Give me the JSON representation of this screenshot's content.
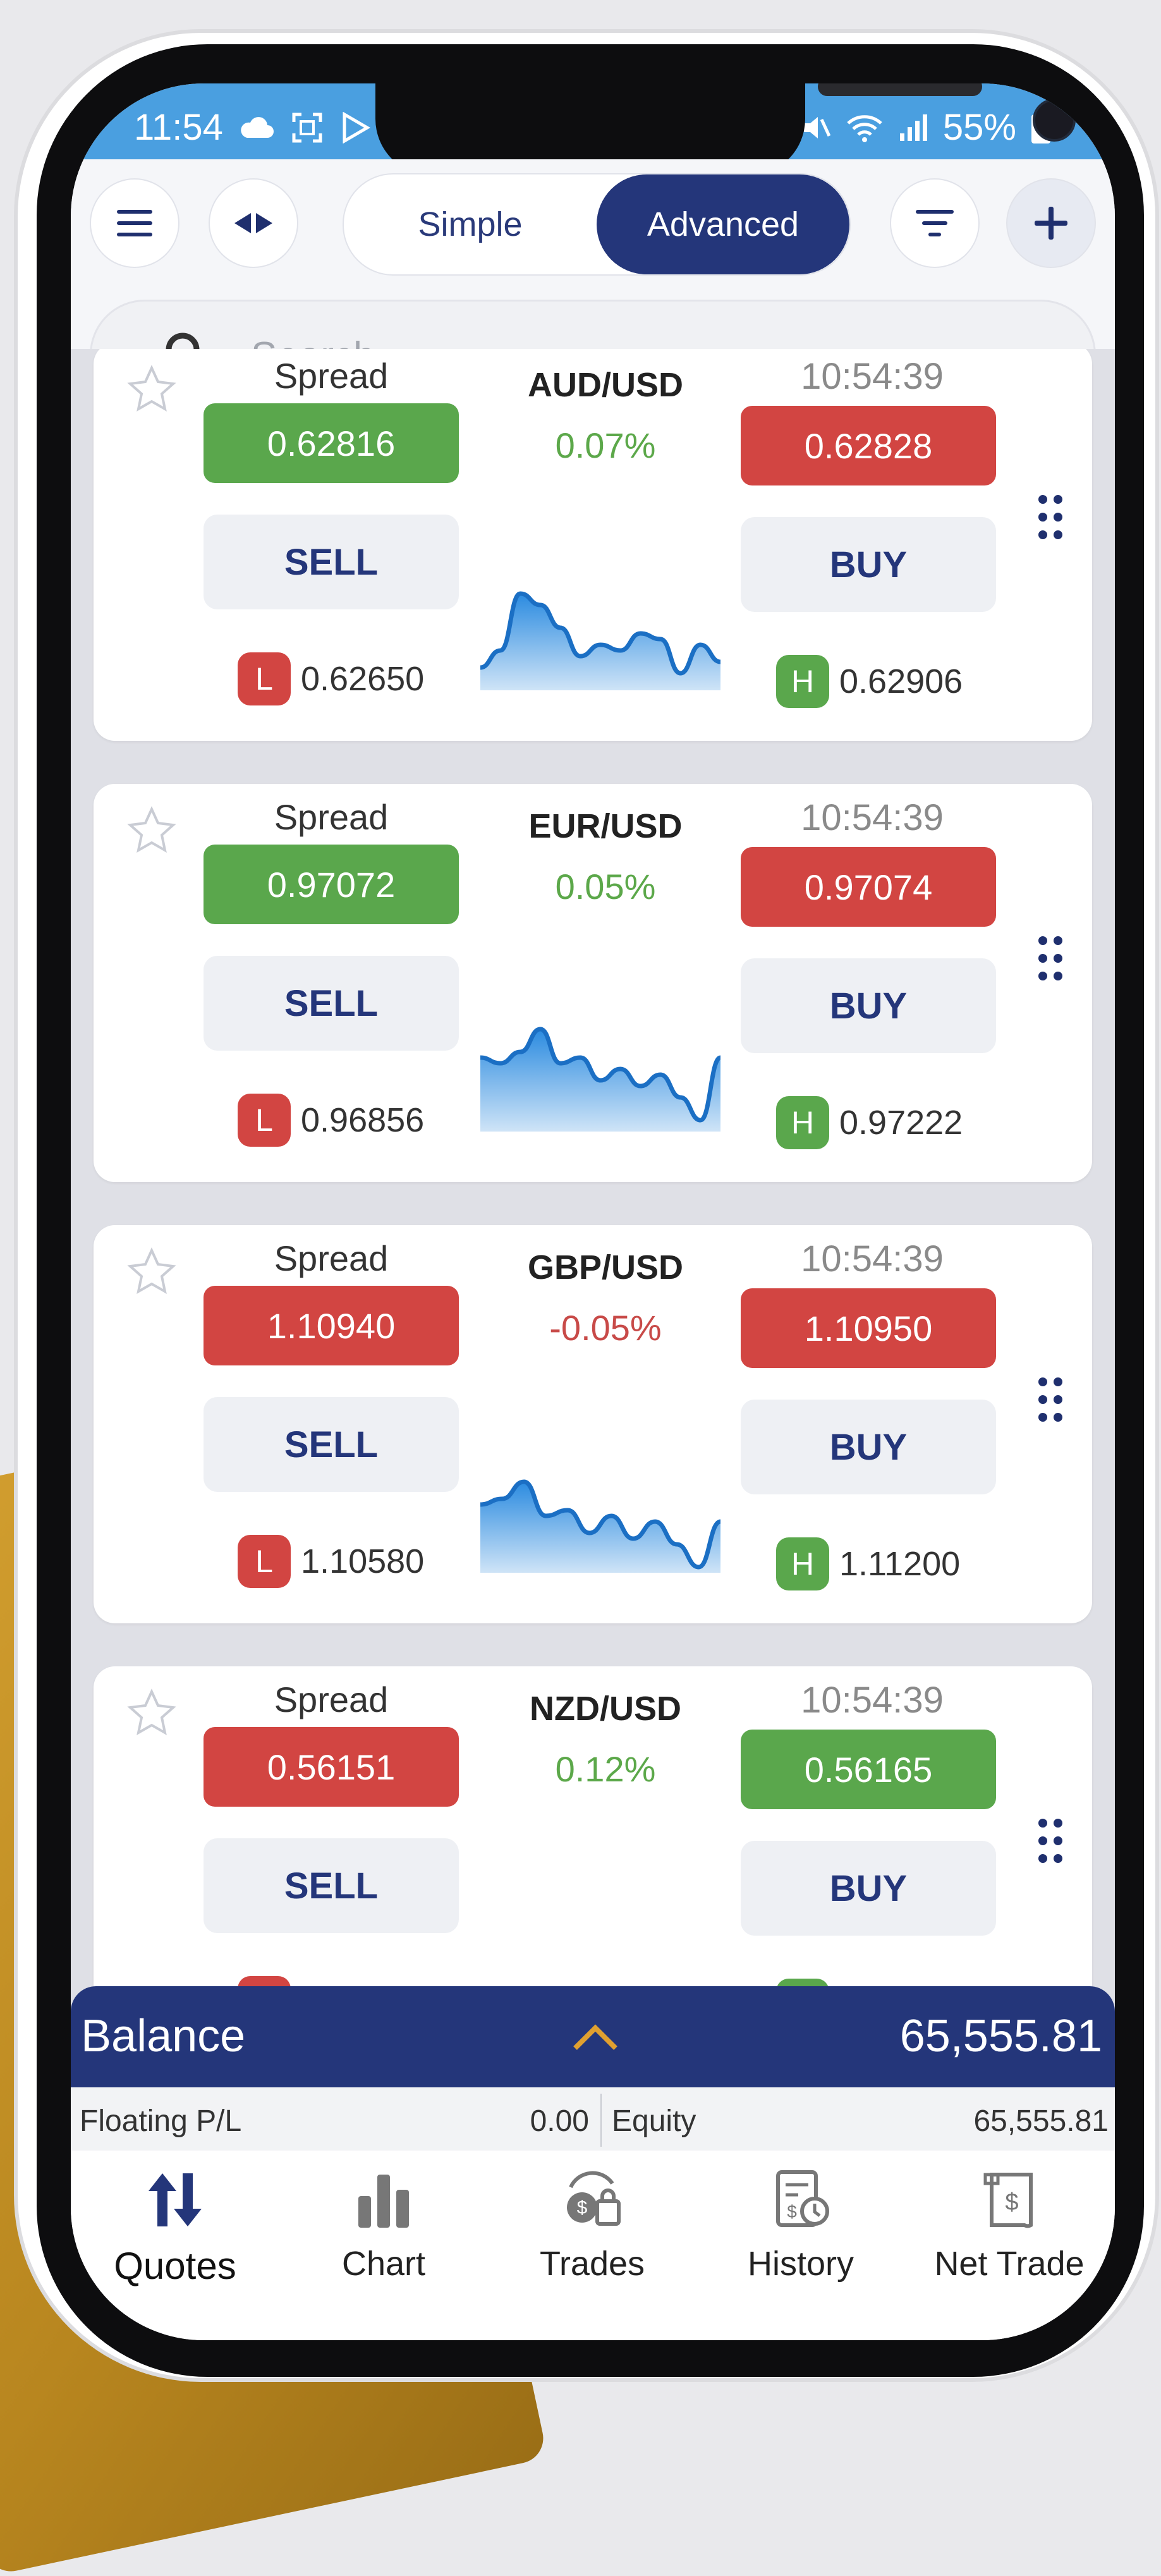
{
  "status_bar": {
    "time": "11:54",
    "battery": "55%"
  },
  "header": {
    "menu_icon": "hamburger-icon",
    "swap_icon": "arrows-left-right-icon",
    "tabs": [
      {
        "label": "Simple",
        "active": false
      },
      {
        "label": "Advanced",
        "active": true
      }
    ],
    "filter_icon": "filter-icon",
    "add_icon": "plus-icon"
  },
  "search": {
    "placeholder": "Search",
    "value": ""
  },
  "quotes": [
    {
      "pair": "AUD/USD",
      "spread_label": "Spread",
      "time": "10:54:39",
      "change": "0.07%",
      "direction": "up",
      "sell_price": "0.62816",
      "sell_color": "green",
      "buy_price": "0.62828",
      "buy_color": "red",
      "sell_label": "SELL",
      "buy_label": "BUY",
      "low_badge": "L",
      "low": "0.62650",
      "high_badge": "H",
      "high": "0.62906",
      "spark": [
        0.2,
        0.35,
        0.85,
        0.75,
        0.55,
        0.3,
        0.4,
        0.35,
        0.5,
        0.45,
        0.15,
        0.4,
        0.25
      ]
    },
    {
      "pair": "EUR/USD",
      "spread_label": "Spread",
      "time": "10:54:39",
      "change": "0.05%",
      "direction": "up",
      "sell_price": "0.97072",
      "sell_color": "green",
      "buy_price": "0.97074",
      "buy_color": "red",
      "sell_label": "SELL",
      "buy_label": "BUY",
      "low_badge": "L",
      "low": "0.96856",
      "high_badge": "H",
      "high": "0.97222",
      "spark": [
        0.65,
        0.6,
        0.7,
        0.9,
        0.6,
        0.65,
        0.45,
        0.55,
        0.4,
        0.5,
        0.3,
        0.1,
        0.65
      ]
    },
    {
      "pair": "GBP/USD",
      "spread_label": "Spread",
      "time": "10:54:39",
      "change": "-0.05%",
      "direction": "down",
      "sell_price": "1.10940",
      "sell_color": "red",
      "buy_price": "1.10950",
      "buy_color": "red",
      "sell_label": "SELL",
      "buy_label": "BUY",
      "low_badge": "L",
      "low": "1.10580",
      "high_badge": "H",
      "high": "1.11200",
      "spark": [
        0.6,
        0.65,
        0.8,
        0.5,
        0.55,
        0.35,
        0.5,
        0.3,
        0.45,
        0.25,
        0.05,
        0.45
      ]
    },
    {
      "pair": "NZD/USD",
      "spread_label": "Spread",
      "time": "10:54:39",
      "change": "0.12%",
      "direction": "up",
      "sell_price": "0.56151",
      "sell_color": "red",
      "buy_price": "0.56165",
      "buy_color": "green",
      "sell_label": "SELL",
      "buy_label": "BUY",
      "low_badge": "L",
      "low": "",
      "high_badge": "H",
      "high": "",
      "spark": []
    }
  ],
  "balance": {
    "label": "Balance",
    "value": "65,555.81",
    "chevron_icon": "chevron-up-icon"
  },
  "summary": {
    "floating_label": "Floating P/L",
    "floating_value": "0.00",
    "equity_label": "Equity",
    "equity_value": "65,555.81"
  },
  "nav": [
    {
      "label": "Quotes",
      "icon": "arrows-up-down-icon",
      "active": true
    },
    {
      "label": "Chart",
      "icon": "bar-chart-icon",
      "active": false
    },
    {
      "label": "Trades",
      "icon": "trades-icon",
      "active": false
    },
    {
      "label": "History",
      "icon": "history-icon",
      "active": false
    },
    {
      "label": "Net Trade",
      "icon": "net-trade-icon",
      "active": false
    }
  ],
  "colors": {
    "primary": "#24367a",
    "green": "#5aa74c",
    "red": "#d24542",
    "status_bar": "#4a9fe0",
    "accent_chevron": "#e0a030"
  }
}
